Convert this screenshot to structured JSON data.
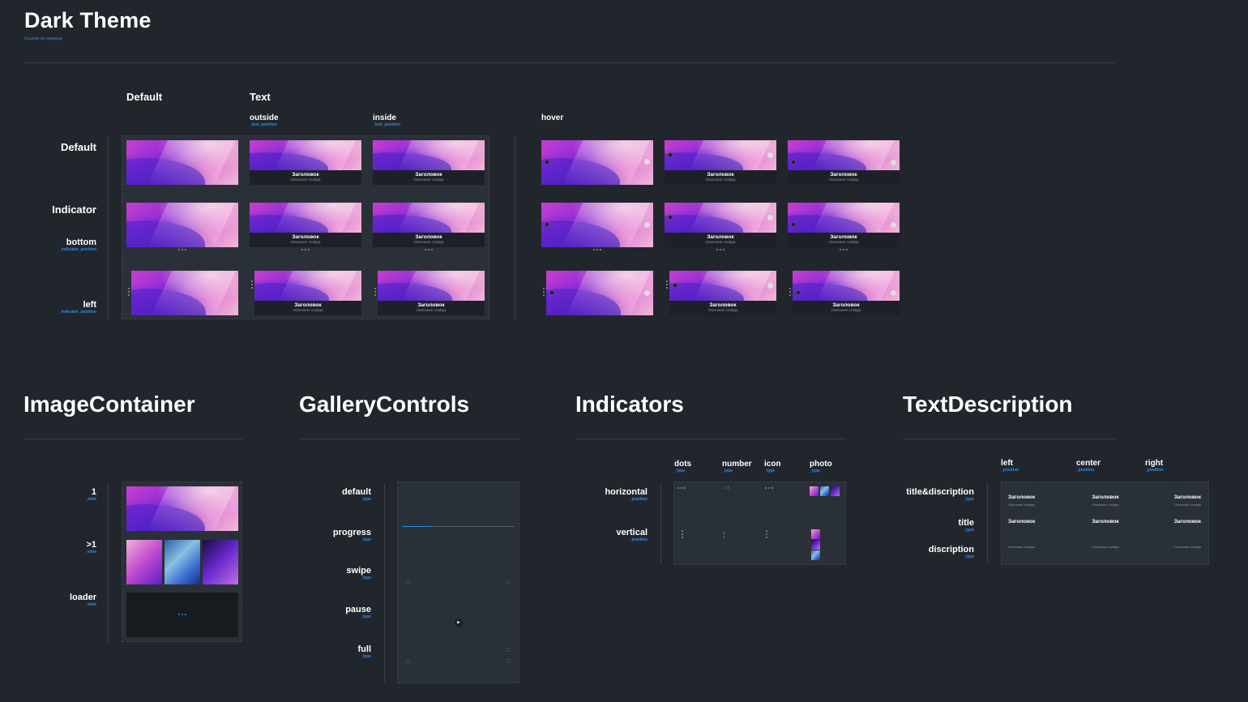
{
  "header": {
    "title": "Dark Theme",
    "link": "Ссылка на страницу"
  },
  "section1": {
    "col_default": "Default",
    "col_text": "Text",
    "outside": "outside",
    "outside_sub": "_text_position",
    "inside": "inside",
    "inside_sub": "_text_position",
    "hover": "hover",
    "row_default": "Default",
    "row_indicator": "Indicator",
    "row_bottom": "bottom",
    "row_bottom_sub": "_indicator_position",
    "row_left": "left",
    "row_left_sub": "_indicator_position",
    "caption_title": "Заголовок",
    "caption_desc": "Описание слайда"
  },
  "image_container": {
    "title": "ImageContainer",
    "rows": [
      {
        "label": "1",
        "sub": "_slide"
      },
      {
        "label": ">1",
        "sub": "_slide"
      },
      {
        "label": "loader",
        "sub": "_slide"
      }
    ]
  },
  "gallery_controls": {
    "title": "GalleryControls",
    "rows": [
      {
        "label": "default",
        "sub": "_type"
      },
      {
        "label": "progress",
        "sub": "_type"
      },
      {
        "label": "swipe",
        "sub": "_type"
      },
      {
        "label": "pause",
        "sub": "_type"
      },
      {
        "label": "full",
        "sub": "_type"
      }
    ]
  },
  "indicators": {
    "title": "Indicators",
    "cols": [
      {
        "label": "dots",
        "sub": "_type"
      },
      {
        "label": "number",
        "sub": "_type"
      },
      {
        "label": "icon",
        "sub": "_type"
      },
      {
        "label": "photo",
        "sub": "_type"
      }
    ],
    "rows": [
      {
        "label": "horizontal",
        "sub": "_position"
      },
      {
        "label": "vertical",
        "sub": "_position"
      }
    ],
    "number_text": "1 / 3"
  },
  "text_description": {
    "title": "TextDescription",
    "cols": [
      {
        "label": "left",
        "sub": "_position"
      },
      {
        "label": "center",
        "sub": "_position"
      },
      {
        "label": "right",
        "sub": "_position"
      }
    ],
    "rows": [
      {
        "label": "title&discription",
        "sub": "_type"
      },
      {
        "label": "title",
        "sub": "_type"
      },
      {
        "label": "discription",
        "sub": "_type"
      }
    ],
    "title_text": "Заголовок",
    "desc_text": "Описание слайда"
  }
}
